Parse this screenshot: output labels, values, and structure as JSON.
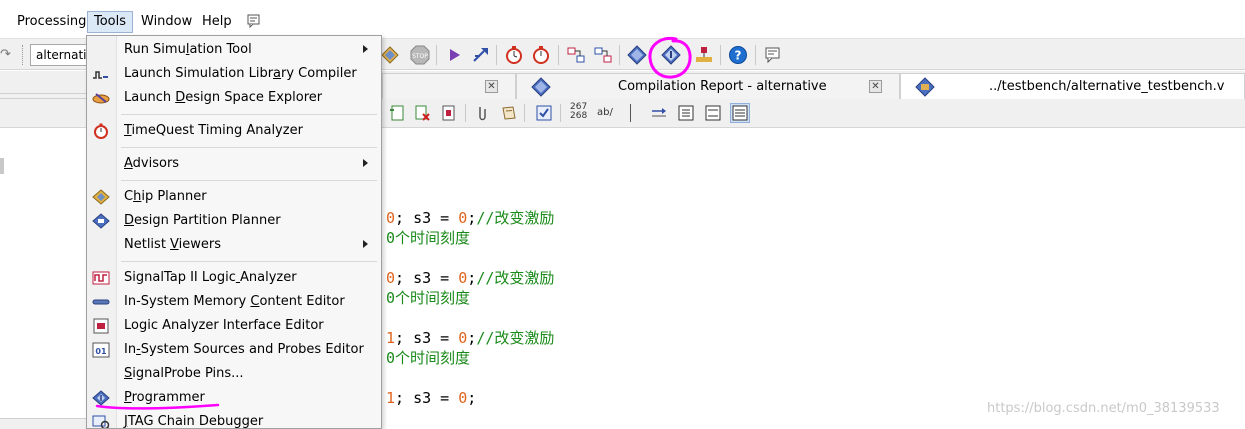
{
  "menubar": {
    "items": [
      {
        "label": "Processing",
        "underline": "P"
      },
      {
        "label": "Tools",
        "underline": "T"
      },
      {
        "label": "Window",
        "underline": "W"
      },
      {
        "label": "Help",
        "underline": "H"
      }
    ],
    "active": "Tools"
  },
  "toolbar": {
    "entity_combo_value": "alternative",
    "icons": [
      "stop-icon",
      "start-analysis-icon",
      "start-compilation-icon",
      "timequest-icon",
      "timing-icon",
      "netlist-viewer-icon",
      "rtl-viewer-icon",
      "assembler-icon",
      "programmer-icon",
      "chip-planner-icon",
      "help-icon",
      "whats-this-icon"
    ]
  },
  "tabs": [
    {
      "label": "",
      "closable": true
    },
    {
      "label": "Compilation Report - alternative",
      "closable": true
    },
    {
      "label": "../testbench/alternative_testbench.v",
      "closable": false
    }
  ],
  "editor_toolbar": {
    "line_numbers_top": "267",
    "line_numbers_bottom": "268",
    "replace_label": "ab/"
  },
  "code": {
    "lines": [
      {
        "parts": [
          {
            "t": "num",
            "v": "0"
          },
          {
            "t": "txt",
            "v": "; s3 = "
          },
          {
            "t": "num",
            "v": "0"
          },
          {
            "t": "txt",
            "v": ";"
          },
          {
            "t": "cmt",
            "v": "//改变激励"
          }
        ]
      },
      {
        "parts": [
          {
            "t": "cmt",
            "v": "0个时间刻度"
          }
        ]
      },
      {
        "parts": [
          {
            "t": "num",
            "v": "0"
          },
          {
            "t": "txt",
            "v": "; s3 = "
          },
          {
            "t": "num",
            "v": "0"
          },
          {
            "t": "txt",
            "v": ";"
          },
          {
            "t": "cmt",
            "v": "//改变激励"
          }
        ]
      },
      {
        "parts": [
          {
            "t": "cmt",
            "v": "0个时间刻度"
          }
        ]
      },
      {
        "parts": [
          {
            "t": "num",
            "v": "1"
          },
          {
            "t": "txt",
            "v": "; s3 = "
          },
          {
            "t": "num",
            "v": "0"
          },
          {
            "t": "txt",
            "v": ";"
          },
          {
            "t": "cmt",
            "v": "//改变激励"
          }
        ]
      },
      {
        "parts": [
          {
            "t": "cmt",
            "v": "0个时间刻度"
          }
        ]
      },
      {
        "parts": [
          {
            "t": "num",
            "v": "1"
          },
          {
            "t": "txt",
            "v": "; s3 = "
          },
          {
            "t": "num",
            "v": "0"
          },
          {
            "t": "txt",
            "v": ";"
          }
        ]
      }
    ]
  },
  "tools_menu": {
    "items": [
      {
        "label": "Run Simulation Tool",
        "icon": "",
        "submenu": true
      },
      {
        "label": "Launch Simulation Library Compiler",
        "icon": "simulation-library-icon",
        "submenu": false
      },
      {
        "label": "Launch Design Space Explorer",
        "icon": "design-space-explorer-icon",
        "submenu": false
      },
      {
        "separator": true
      },
      {
        "label": "TimeQuest Timing Analyzer",
        "icon": "stopwatch-icon",
        "submenu": false
      },
      {
        "separator": true
      },
      {
        "label": "Advisors",
        "icon": "",
        "submenu": true
      },
      {
        "separator": true
      },
      {
        "label": "Chip Planner",
        "icon": "chip-planner-icon",
        "submenu": false
      },
      {
        "label": "Design Partition Planner",
        "icon": "design-partition-icon",
        "submenu": false
      },
      {
        "label": "Netlist Viewers",
        "icon": "",
        "submenu": true
      },
      {
        "separator": true
      },
      {
        "label": "SignalTap II Logic Analyzer",
        "icon": "signaltap-icon",
        "submenu": false
      },
      {
        "label": "In-System Memory Content Editor",
        "icon": "memory-editor-icon",
        "submenu": false
      },
      {
        "label": "Logic Analyzer Interface Editor",
        "icon": "logic-analyzer-interface-icon",
        "submenu": false
      },
      {
        "label": "In-System Sources and Probes Editor",
        "icon": "sources-probes-icon",
        "submenu": false
      },
      {
        "label": "SignalProbe Pins...",
        "icon": "",
        "submenu": false
      },
      {
        "label": "Programmer",
        "icon": "programmer-icon",
        "submenu": false
      },
      {
        "label": "JTAG Chain Debugger",
        "icon": "jtag-debugger-icon",
        "submenu": false
      }
    ]
  },
  "watermark": "https://blog.csdn.net/m0_38139533",
  "colors": {
    "annotation": "#ff00ff",
    "code_number": "#e0641e",
    "code_comment": "#1a8a1a",
    "menu_highlight": "#dbe8f6"
  }
}
